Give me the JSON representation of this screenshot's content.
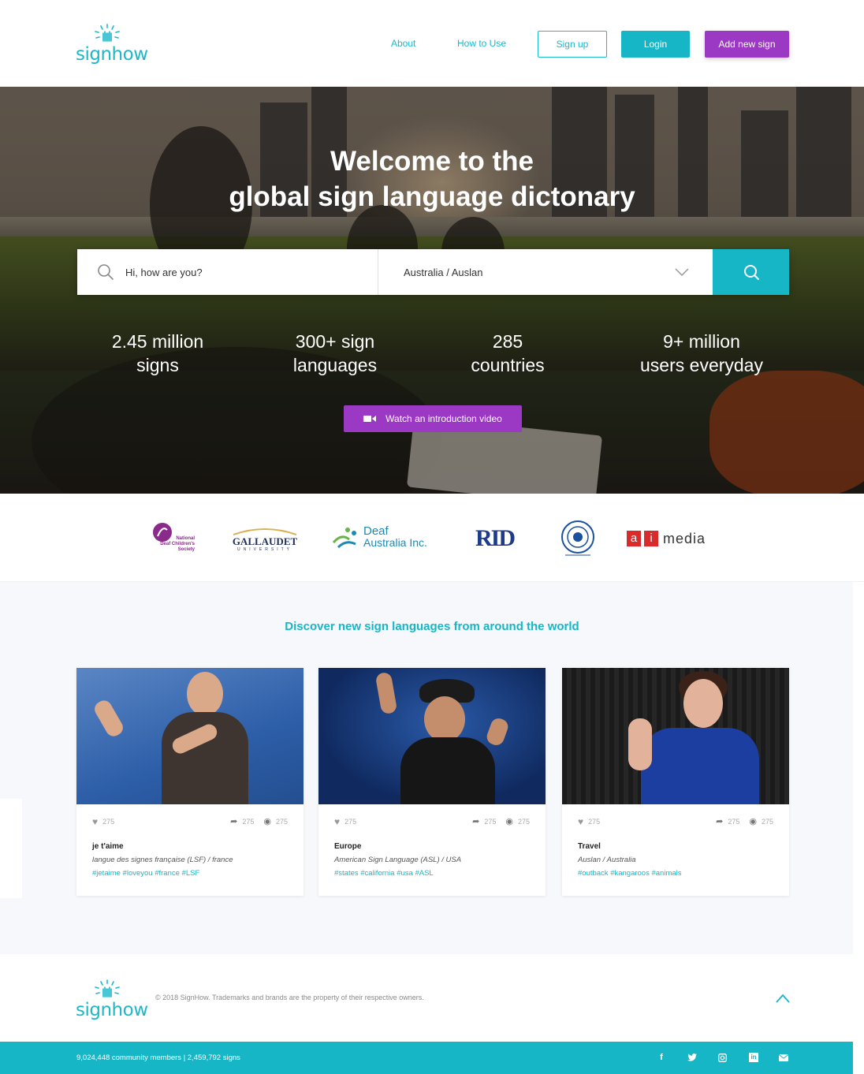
{
  "header": {
    "logo_text": "signhow",
    "nav": {
      "about": "About",
      "how_to_use": "How to Use"
    },
    "buttons": {
      "signup": "Sign up",
      "login": "Login",
      "add": "Add new sign"
    }
  },
  "hero": {
    "title_line1": "Welcome to the",
    "title_line2": "global sign language dictonary",
    "search": {
      "query": "Hi, how are you?",
      "language": "Australia / Auslan"
    },
    "stats": [
      {
        "line1": "2.45 million",
        "line2": "signs"
      },
      {
        "line1": "300+ sign",
        "line2": "languages"
      },
      {
        "line1": "285",
        "line2": "countries"
      },
      {
        "line1": "9+ million",
        "line2": "users everyday"
      }
    ],
    "video_button": "Watch an introduction video"
  },
  "partners": {
    "ndcs": {
      "line1": "National",
      "line2": "Deaf Children's",
      "line3": "Society"
    },
    "gallaudet": {
      "name": "GALLAUDET",
      "sub": "UNIVERSITY"
    },
    "deaf_australia": {
      "line1": "Deaf",
      "line2": "Australia Inc."
    },
    "rid": "RID",
    "aimedia": {
      "a": "a",
      "i": "i",
      "media": "media"
    }
  },
  "discover": {
    "title": "Discover new sign languages from around the world",
    "cards": [
      {
        "likes": "275",
        "shares": "275",
        "views": "275",
        "title": "je t'aime",
        "subtitle": "langue des signes française (LSF) / france",
        "tags": "#jetaime #loveyou #france #LSF"
      },
      {
        "likes": "275",
        "shares": "275",
        "views": "275",
        "title": "Europe",
        "subtitle": "American Sign Language (ASL) / USA",
        "tags": "#states #california #usa #ASL"
      },
      {
        "likes": "275",
        "shares": "275",
        "views": "275",
        "title": "Travel",
        "subtitle": "Auslan / Australia",
        "tags": "#outback #kangaroos #animals"
      }
    ]
  },
  "footer": {
    "copyright": "© 2018 SignHow. Trademarks and brands are the property of their respective owners.",
    "stats": "9,024,448 community members  |  2,459,792 signs",
    "social": {
      "facebook": "f",
      "twitter": "twitter-icon",
      "instagram": "instagram-icon",
      "linkedin": "in",
      "email": "email-icon"
    }
  },
  "colors": {
    "teal": "#17b6c6",
    "purple": "#9b38c4"
  }
}
